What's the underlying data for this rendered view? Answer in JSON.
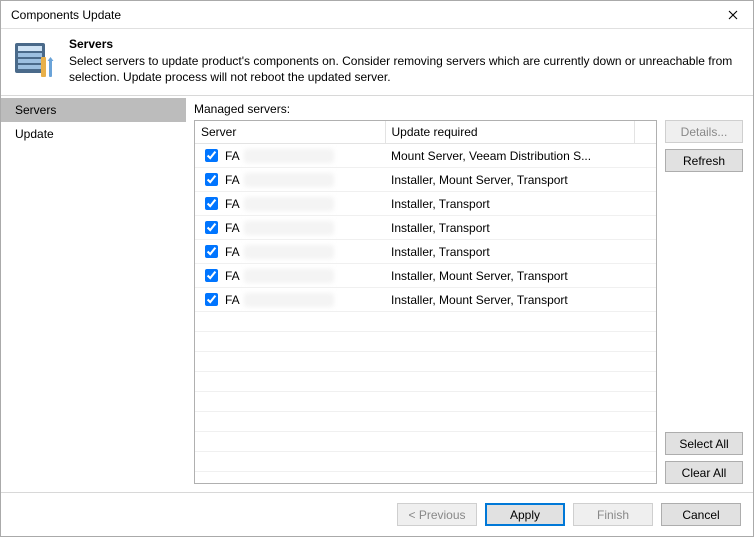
{
  "window": {
    "title": "Components Update"
  },
  "header": {
    "title": "Servers",
    "subtitle": "Select servers to update product's components on. Consider removing servers which are currently down or unreachable from selection. Update process will not reboot the updated server."
  },
  "sidebar": {
    "items": [
      {
        "label": "Servers",
        "selected": true
      },
      {
        "label": "Update",
        "selected": false
      }
    ]
  },
  "grid": {
    "label": "Managed servers:",
    "columns": {
      "server": "Server",
      "update": "Update required"
    },
    "rows": [
      {
        "checked": true,
        "server_prefix": "FA",
        "update": "Mount Server, Veeam Distribution S..."
      },
      {
        "checked": true,
        "server_prefix": "FA",
        "update": "Installer, Mount Server, Transport"
      },
      {
        "checked": true,
        "server_prefix": "FA",
        "update": "Installer, Transport"
      },
      {
        "checked": true,
        "server_prefix": "FA",
        "update": "Installer, Transport"
      },
      {
        "checked": true,
        "server_prefix": "FA",
        "update": "Installer, Transport"
      },
      {
        "checked": true,
        "server_prefix": "FA",
        "update": "Installer, Mount Server, Transport"
      },
      {
        "checked": true,
        "server_prefix": "FA",
        "update": "Installer, Mount Server, Transport"
      }
    ]
  },
  "buttons": {
    "details": "Details...",
    "refresh": "Refresh",
    "select_all": "Select All",
    "clear_all": "Clear All",
    "previous": "< Previous",
    "apply": "Apply",
    "finish": "Finish",
    "cancel": "Cancel"
  }
}
